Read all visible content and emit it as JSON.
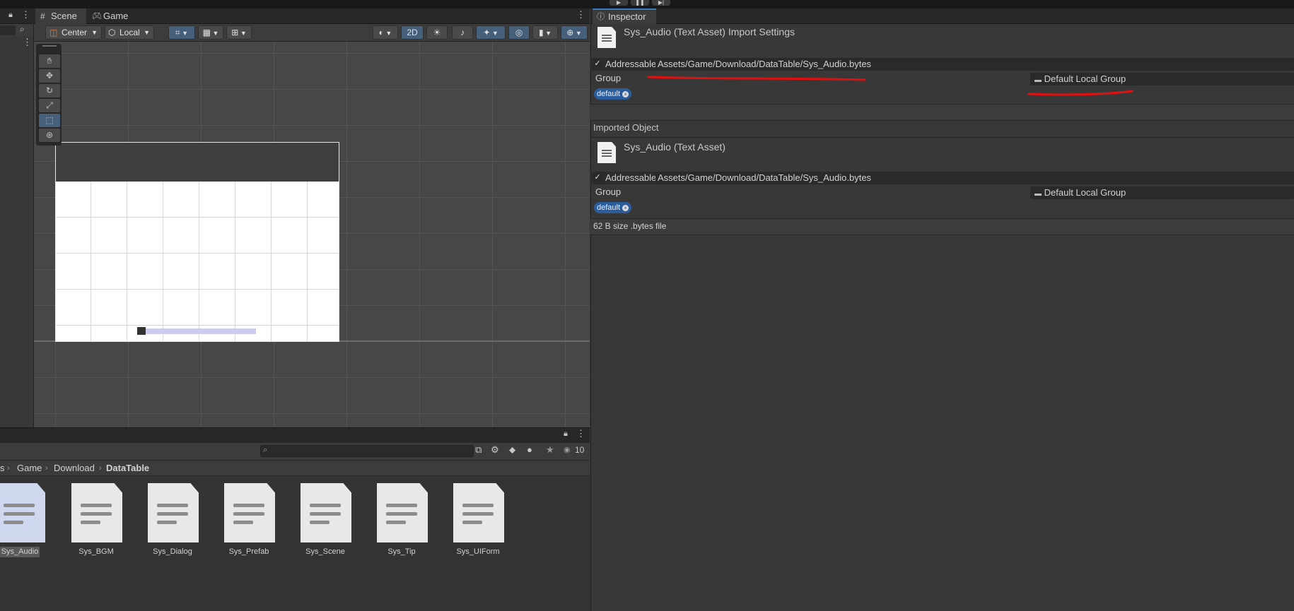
{
  "scene": {
    "tabs": [
      {
        "label": "Scene",
        "icon": "hash-icon"
      },
      {
        "label": "Game",
        "icon": "gamepad-icon"
      }
    ],
    "toolbar": {
      "pivot_label": "Center",
      "space_label": "Local",
      "mode_2d": "2D"
    }
  },
  "project": {
    "breadcrumb": [
      "s",
      "Game",
      "Download",
      "DataTable"
    ],
    "search_placeholder": "",
    "visible_count": "10",
    "files": [
      "Sys_Audio",
      "Sys_BGM",
      "Sys_Dialog",
      "Sys_Prefab",
      "Sys_Scene",
      "Sys_Tip",
      "Sys_UIForm"
    ]
  },
  "inspector": {
    "tab_label": "Inspector",
    "header_title": "Sys_Audio (Text Asset) Import Settings",
    "addressable_label": "Addressable",
    "address": "Assets/Game/Download/DataTable/Sys_Audio.bytes",
    "group_label": "Group",
    "group_value": "Default Local Group",
    "label_tag": "default",
    "imported_object_label": "Imported Object",
    "imported_title": "Sys_Audio (Text Asset)",
    "size_info": "62 B size .bytes file"
  },
  "colors": {
    "accent": "#3a79bb",
    "annotation": "#e01010",
    "label_pill": "#2b5d9c"
  }
}
